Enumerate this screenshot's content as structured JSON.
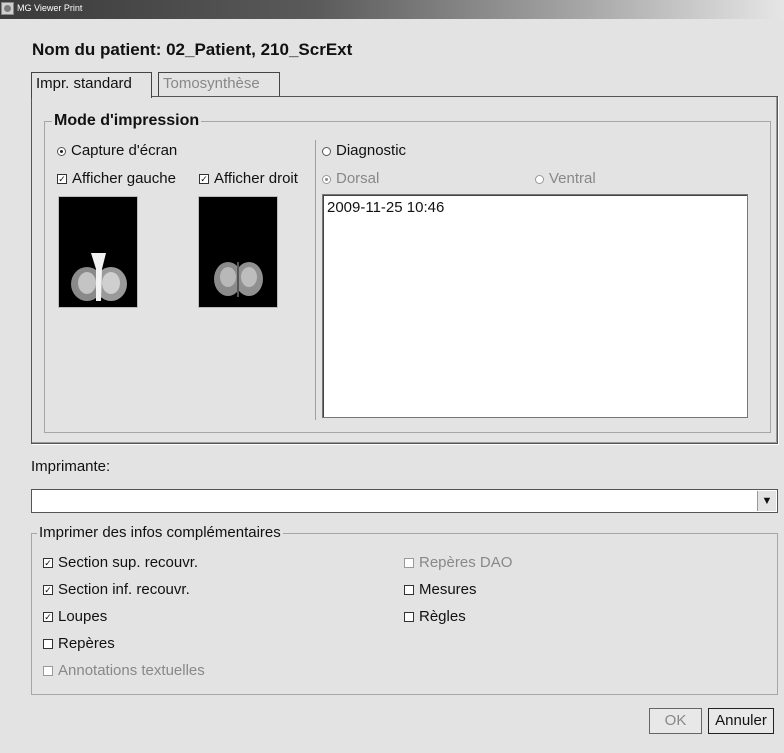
{
  "window": {
    "title": "MG Viewer Print"
  },
  "patient_label": "Nom du patient: 02_Patient, 210_ScrExt",
  "tabs": [
    {
      "label": "Impr. standard",
      "active": true
    },
    {
      "label": "Tomosynthèse",
      "active": false
    }
  ],
  "print_mode": {
    "group_title": "Mode d'impression",
    "screen_capture": {
      "label": "Capture d'écran",
      "selected": true
    },
    "show_left": {
      "label": "Afficher gauche",
      "checked": true
    },
    "show_right": {
      "label": "Afficher droit",
      "checked": true
    },
    "diagnostic": {
      "label": "Diagnostic",
      "selected": false
    },
    "dorsal": {
      "label": "Dorsal",
      "selected": true,
      "enabled": false
    },
    "ventral": {
      "label": "Ventral",
      "selected": false,
      "enabled": false
    },
    "studies": [
      "2009-11-25 10:46"
    ]
  },
  "printer": {
    "label": "Imprimante:",
    "value": ""
  },
  "extra_info": {
    "group_title": "Imprimer des infos complémentaires",
    "left_items": [
      {
        "label": "Section sup. recouvr.",
        "checked": true,
        "enabled": true
      },
      {
        "label": "Section inf. recouvr.",
        "checked": true,
        "enabled": true
      },
      {
        "label": "Loupes",
        "checked": true,
        "enabled": true
      },
      {
        "label": "Repères",
        "checked": false,
        "enabled": true
      },
      {
        "label": "Annotations textuelles",
        "checked": false,
        "enabled": false
      }
    ],
    "right_items": [
      {
        "label": "Repères DAO",
        "checked": false,
        "enabled": false
      },
      {
        "label": "Mesures",
        "checked": false,
        "enabled": true
      },
      {
        "label": "Règles",
        "checked": false,
        "enabled": true
      }
    ]
  },
  "buttons": {
    "ok": "OK",
    "cancel": "Annuler"
  }
}
